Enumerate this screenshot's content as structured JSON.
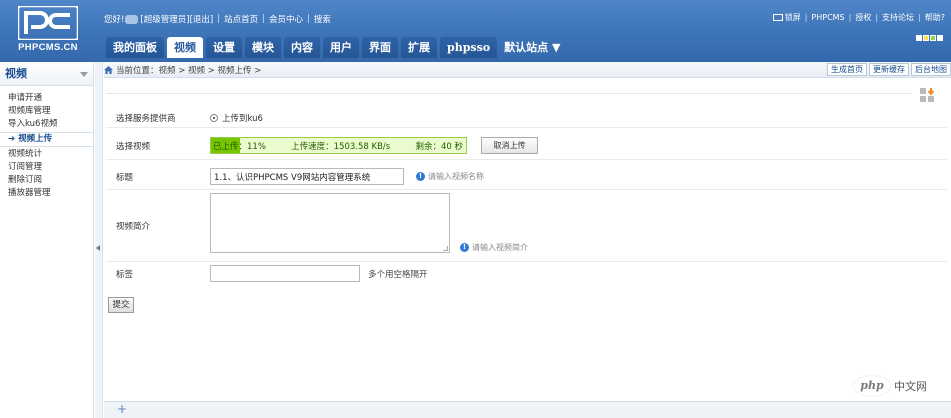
{
  "header": {
    "logo_text": "PHPCMS.CN",
    "greeting": "您好!",
    "role": "[超级管理员]",
    "logout": "[退出]",
    "site_home": "站点首页",
    "member_center": "会员中心",
    "search": "搜索",
    "right_links": [
      "锁屏",
      "PHPCMS",
      "授权",
      "支持论坛",
      "帮助?"
    ],
    "skin_colors": [
      "#ffffff",
      "#ffe14d",
      "#8dd94a",
      "#ffffff"
    ]
  },
  "nav": {
    "tabs": [
      {
        "label": "我的面板",
        "active": false
      },
      {
        "label": "视频",
        "active": true
      },
      {
        "label": "设置",
        "active": false
      },
      {
        "label": "模块",
        "active": false
      },
      {
        "label": "内容",
        "active": false
      },
      {
        "label": "用户",
        "active": false
      },
      {
        "label": "界面",
        "active": false
      },
      {
        "label": "扩展",
        "active": false
      },
      {
        "label": "phpsso",
        "active": false
      }
    ],
    "site_select": "默认站点"
  },
  "sidebar": {
    "title": "视频",
    "items": [
      {
        "label": "申请开通",
        "active": false
      },
      {
        "label": "视频库管理",
        "active": false
      },
      {
        "label": "导入ku6视频",
        "active": false
      },
      {
        "label": "视频上传",
        "active": true
      },
      {
        "label": "视频统计",
        "active": false
      },
      {
        "label": "订阅管理",
        "active": false
      },
      {
        "label": "删除订阅",
        "active": false
      },
      {
        "label": "播放器管理",
        "active": false
      }
    ]
  },
  "breadcrumb": {
    "text": "当前位置：视频 > 视频 > 视频上传 >",
    "actions": [
      "生成首页",
      "更新缓存",
      "后台地图"
    ]
  },
  "form": {
    "provider_label": "选择服务提供商",
    "provider_option": "上传到ku6",
    "file_label": "选择视频",
    "progress": {
      "uploaded_text": "已上传：11%",
      "speed_text": "上传速度：1503.58 KB/s",
      "remaining_text": "剩余：40 秒",
      "percent": 11
    },
    "cancel_upload": "取消上传",
    "title_label": "标题",
    "title_value": "1.1、认识PHPCMS V9网站内容管理系统",
    "title_hint": "请输入视频名称",
    "desc_label": "视频简介",
    "desc_value": "",
    "desc_hint": "请输入视频简介",
    "tags_label": "标签",
    "tags_value": "",
    "tags_hint": "多个用空格隔开",
    "submit": "提交"
  },
  "footer": {
    "plus": "+"
  },
  "watermark": {
    "badge": "php",
    "text": "中文网"
  }
}
